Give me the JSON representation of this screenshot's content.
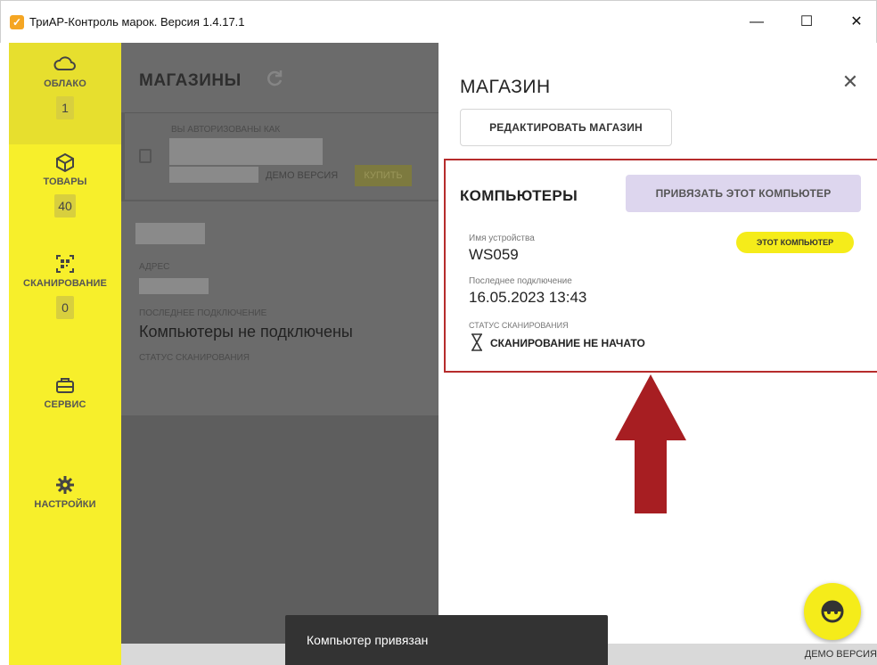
{
  "window": {
    "title": "ТриАР-Контроль марок. Версия 1.4.17.1",
    "app_icon": "checkmark-icon",
    "minimize": "—",
    "maximize": "☐",
    "close": "✕"
  },
  "sidebar": {
    "items": [
      {
        "label": "ОБЛАКО",
        "icon": "cloud-icon",
        "badge": "1"
      },
      {
        "label": "ТОВАРЫ",
        "icon": "box-icon",
        "badge": "40"
      },
      {
        "label": "СКАНИРОВАНИЕ",
        "icon": "qr-scan-icon",
        "badge": "0"
      },
      {
        "label": "СЕРВИС",
        "icon": "toolbox-icon"
      },
      {
        "label": "НАСТРОЙКИ",
        "icon": "gear-icon"
      }
    ]
  },
  "stores": {
    "title": "МАГАЗИНЫ",
    "auth_label": "ВЫ АВТОРИЗОВАНЫ КАК",
    "demo_label": "ДЕМО ВЕРСИЯ",
    "buy_label": "КУПИТЬ",
    "address_label": "АДРЕС",
    "last_conn_label": "ПОСЛЕДНЕЕ ПОДКЛЮЧЕНИЕ",
    "last_conn_value": "Компьютеры не подключены",
    "scan_status_label": "СТАТУС СКАНИРОВАНИЯ"
  },
  "panel": {
    "title": "МАГАЗИН",
    "close": "✕",
    "edit_button": "РЕДАКТИРОВАТЬ МАГАЗИН",
    "computers": {
      "title": "КОМПЬЮТЕРЫ",
      "bind_button": "ПРИВЯЗАТЬ ЭТОТ КОМПЬЮТЕР",
      "device_label": "Имя устройства",
      "device_value": "WS059",
      "this_badge": "ЭТОТ КОМПЬЮТЕР",
      "last_conn_label": "Последнее подключение",
      "last_conn_value": "16.05.2023 13:43",
      "scan_label": "СТАТУС СКАНИРОВАНИЯ",
      "scan_value": "СКАНИРОВАНИЕ НЕ НАЧАТО"
    }
  },
  "toast": "Компьютер привязан",
  "footer": {
    "demo": "ДЕМО ВЕРСИЯ"
  },
  "colors": {
    "accent_yellow": "#f7ef2b",
    "highlight_red": "#b62c2c",
    "arrow_red": "#a71e22",
    "bind_button": "#ddd6ee"
  }
}
